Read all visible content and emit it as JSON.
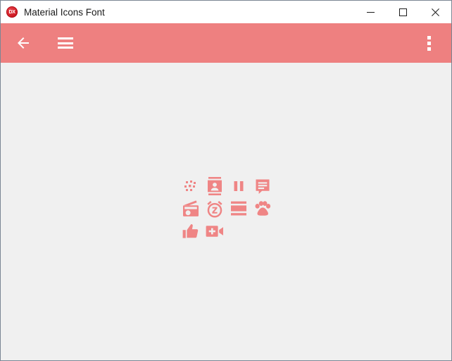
{
  "window": {
    "title": "Material Icons Font",
    "app_icon": "devexpress-dx-logo",
    "app_icon_text": "DX",
    "controls": {
      "minimize": "Minimize",
      "maximize": "Maximize",
      "close": "Close"
    }
  },
  "appbar": {
    "background_color": "#ee8080",
    "foreground_color": "#ffffff",
    "back_label": "Back",
    "menu_label": "Menu",
    "overflow_label": "More options"
  },
  "content": {
    "background_color": "#f0f0f0",
    "icon_color": "#ef8585",
    "icons": [
      {
        "name": "blur-on-icon",
        "label": "blur_on"
      },
      {
        "name": "contacts-icon",
        "label": "contacts"
      },
      {
        "name": "pause-icon",
        "label": "pause"
      },
      {
        "name": "comment-icon",
        "label": "comment"
      },
      {
        "name": "radio-icon",
        "label": "radio"
      },
      {
        "name": "snooze-icon",
        "label": "snooze"
      },
      {
        "name": "table-rows-icon",
        "label": "table_rows"
      },
      {
        "name": "pets-icon",
        "label": "pets"
      },
      {
        "name": "thumb-up-icon",
        "label": "thumb_up"
      },
      {
        "name": "video-call-icon",
        "label": "video_call"
      }
    ]
  }
}
